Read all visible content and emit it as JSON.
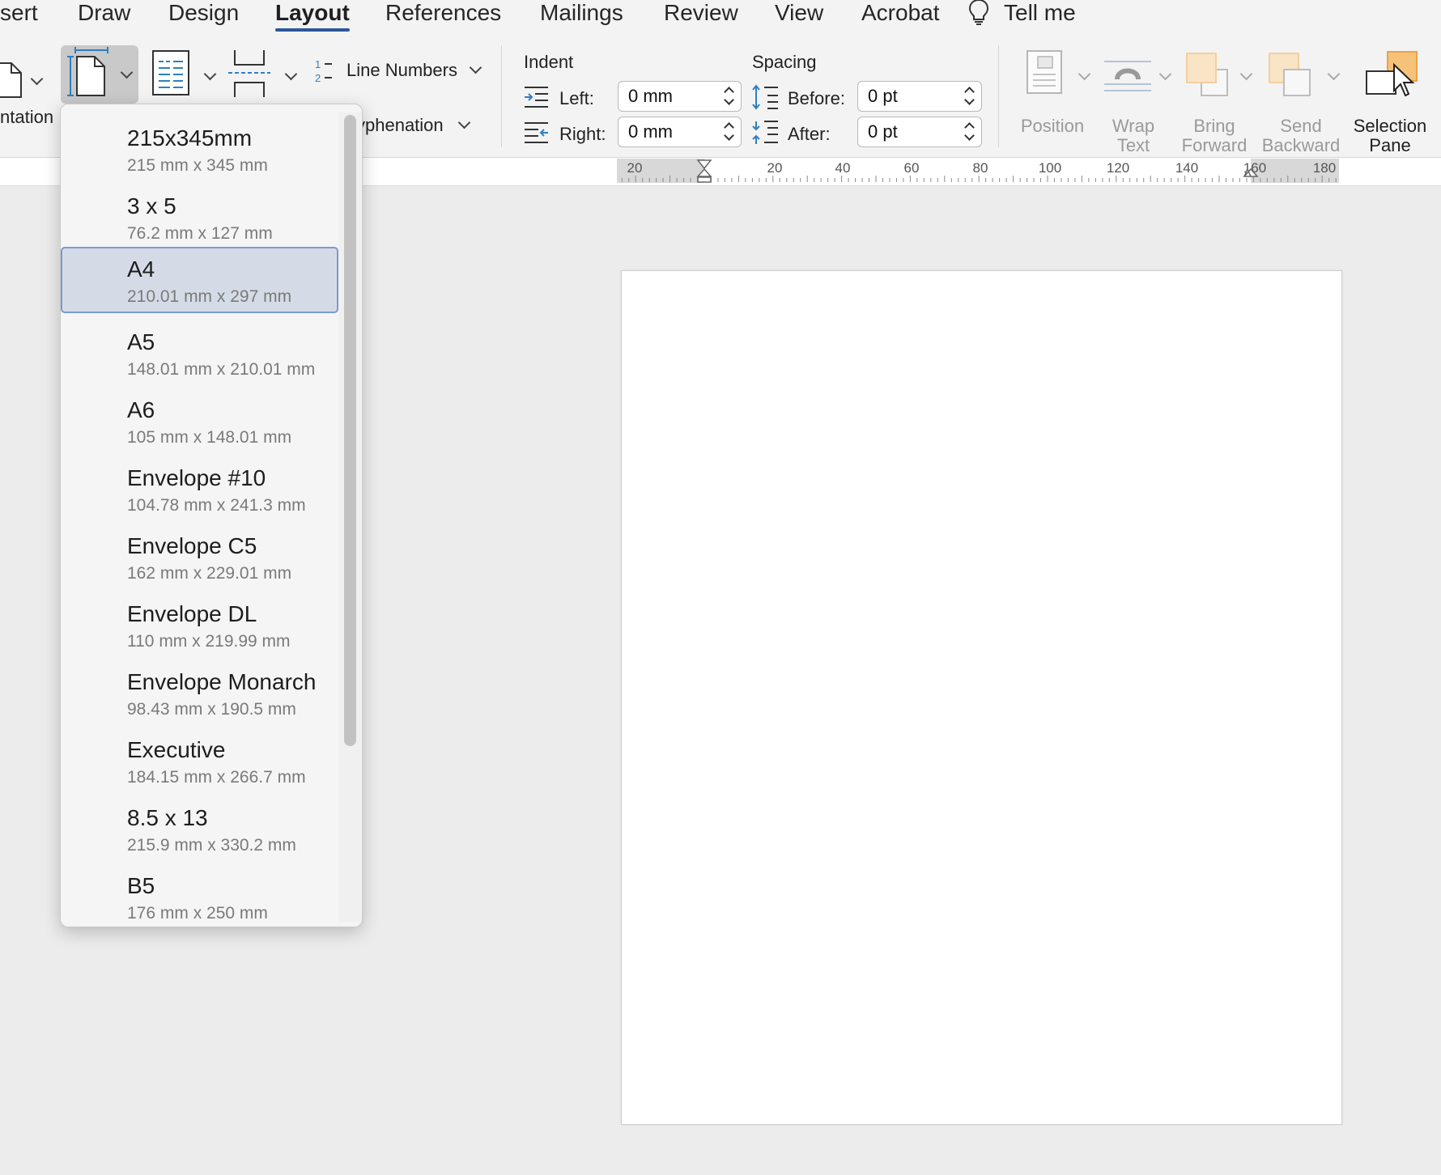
{
  "tabs": [
    {
      "label": "sert"
    },
    {
      "label": "Draw"
    },
    {
      "label": "Design"
    },
    {
      "label": "Layout",
      "active": true
    },
    {
      "label": "References"
    },
    {
      "label": "Mailings"
    },
    {
      "label": "Review"
    },
    {
      "label": "View"
    },
    {
      "label": "Acrobat"
    }
  ],
  "tell_me": {
    "label": "Tell me",
    "icon": "lightbulb-icon"
  },
  "page_setup": {
    "orientation_label": "ntation",
    "line_numbers_label": "Line Numbers",
    "hyphenation_label": "yphenation",
    "icons": [
      "orientation-icon",
      "size-icon",
      "columns-icon",
      "breaks-icon",
      "line-numbers-icon"
    ]
  },
  "indent": {
    "title": "Indent",
    "left_label": "Left:",
    "left_value": "0 mm",
    "right_label": "Right:",
    "right_value": "0 mm"
  },
  "spacing": {
    "title": "Spacing",
    "before_label": "Before:",
    "before_value": "0 pt",
    "after_label": "After:",
    "after_value": "0 pt"
  },
  "arrange": {
    "position": {
      "line1": "Position",
      "line2": ""
    },
    "wrap_text": {
      "line1": "Wrap",
      "line2": "Text"
    },
    "bring_forward": {
      "line1": "Bring",
      "line2": "Forward"
    },
    "send_backward": {
      "line1": "Send",
      "line2": "Backward"
    },
    "selection_pane": {
      "line1": "Selection",
      "line2": "Pane"
    }
  },
  "ruler": {
    "labels": [
      "20",
      "20",
      "40",
      "60",
      "80",
      "100",
      "120",
      "140",
      "160",
      "180"
    ]
  },
  "size_menu": {
    "selected": "A4",
    "items": [
      {
        "name": "215x345mm",
        "dims": "215 mm x 345 mm"
      },
      {
        "name": "3 x 5",
        "dims": "76.2 mm x 127 mm"
      },
      {
        "name": "A4",
        "dims": "210.01 mm x 297 mm"
      },
      {
        "name": "A5",
        "dims": "148.01 mm x 210.01 mm"
      },
      {
        "name": "A6",
        "dims": "105 mm x 148.01 mm"
      },
      {
        "name": "Envelope #10",
        "dims": "104.78 mm x 241.3 mm"
      },
      {
        "name": "Envelope C5",
        "dims": "162 mm x 229.01 mm"
      },
      {
        "name": "Envelope DL",
        "dims": "110 mm x 219.99 mm"
      },
      {
        "name": "Envelope Monarch",
        "dims": "98.43 mm x 190.5 mm"
      },
      {
        "name": "Executive",
        "dims": "184.15 mm x 266.7 mm"
      },
      {
        "name": "8.5 x 13",
        "dims": "215.9 mm x 330.2 mm"
      },
      {
        "name": "B5",
        "dims": "176 mm x 250 mm"
      }
    ]
  },
  "colors": {
    "accent": "#2b579a",
    "selected_bg": "#d5dbe6",
    "selected_border": "#7b9ad0",
    "arrange_orange": "#f6c27a"
  }
}
